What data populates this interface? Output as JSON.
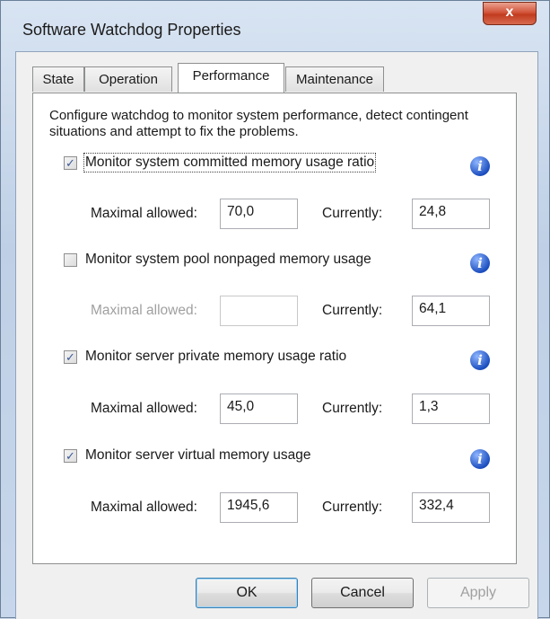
{
  "window": {
    "title": "Software Watchdog Properties",
    "close_glyph": "x"
  },
  "tabs": [
    {
      "label": "State"
    },
    {
      "label": "Operation"
    },
    {
      "label": "Performance"
    },
    {
      "label": "Maintenance"
    }
  ],
  "active_tab": "Performance",
  "description": "Configure watchdog to monitor system performance, detect contingent situations and attempt to fix the problems.",
  "monitors": [
    {
      "label": "Monitor system committed memory usage ratio",
      "checked": true,
      "max_label": "Maximal allowed:",
      "max_value": "70,0",
      "current_label": "Currently:",
      "current_value": "24,8",
      "enabled": true
    },
    {
      "label": "Monitor system pool nonpaged memory usage",
      "checked": false,
      "max_label": "Maximal allowed:",
      "max_value": "",
      "current_label": "Currently:",
      "current_value": "64,1",
      "enabled": false
    },
    {
      "label": "Monitor server private memory usage ratio",
      "checked": true,
      "max_label": "Maximal allowed:",
      "max_value": "45,0",
      "current_label": "Currently:",
      "current_value": "1,3",
      "enabled": true
    },
    {
      "label": "Monitor server virtual memory usage",
      "checked": true,
      "max_label": "Maximal allowed:",
      "max_value": "1945,6",
      "current_label": "Currently:",
      "current_value": "332,4",
      "enabled": true
    }
  ],
  "buttons": {
    "ok": "OK",
    "cancel": "Cancel",
    "apply": "Apply"
  },
  "icons": {
    "info": "info-icon",
    "check": "check-icon",
    "close": "close-icon"
  }
}
